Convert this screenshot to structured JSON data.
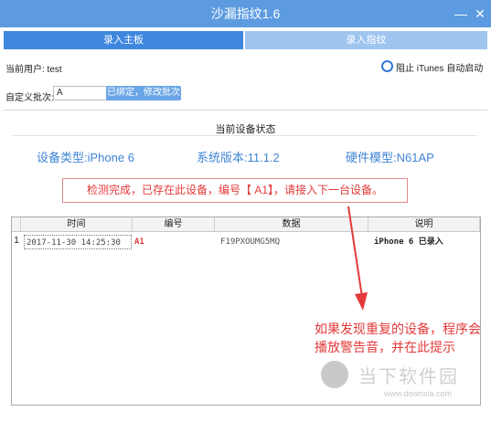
{
  "window": {
    "title": "沙漏指纹1.6",
    "minimize": "—",
    "close": "✕"
  },
  "tabs": [
    {
      "label": "录入主板"
    },
    {
      "label": "录入指纹"
    }
  ],
  "user": {
    "label": "当前用户: test"
  },
  "itunes": {
    "label": "阻止 iTunes 自动启动"
  },
  "batch": {
    "label": "自定义批次:",
    "value": "A",
    "button": "已绑定，修改批次"
  },
  "status": {
    "title": "当前设备状态",
    "device_type": "设备类型:iPhone 6",
    "os_version": "系统版本:11.1.2",
    "hw_model": "硬件模型:N61AP",
    "alert": "检测完成，已存在此设备，编号【 A1】，请接入下一台设备。"
  },
  "table": {
    "headers": [
      "时间",
      "编号",
      "数据",
      "说明"
    ],
    "rows": [
      {
        "index": "1",
        "time": "2017-11-30 14:25:30",
        "number": "A1",
        "data": "F19PXOUMG5MQ",
        "desc": "iPhone 6 已录入"
      }
    ]
  },
  "annotation": {
    "text": "如果发现重复的设备，程序会播放警告音，并在此提示"
  },
  "watermark": {
    "text": "当下软件园",
    "url": "www.downxia.com"
  },
  "colors": {
    "title_bar": "#5c9be0",
    "tab_active": "#3f87de",
    "alert_red": "#e23a3a",
    "info_blue": "#3f85d4"
  }
}
